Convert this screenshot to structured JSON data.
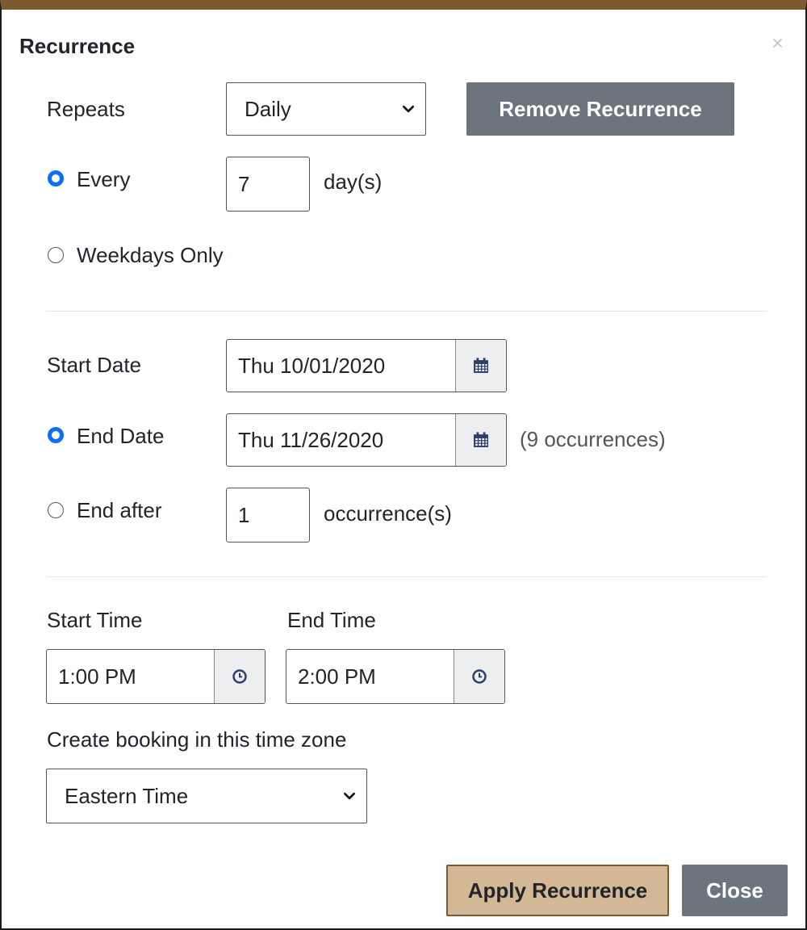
{
  "dialog": {
    "title": "Recurrence",
    "close_glyph": "×"
  },
  "repeats": {
    "label": "Repeats",
    "selected": "Daily",
    "remove_button": "Remove Recurrence"
  },
  "frequency": {
    "every_label": "Every",
    "every_value": "7",
    "every_unit": "day(s)",
    "every_checked": true,
    "weekdays_label": "Weekdays Only",
    "weekdays_checked": false
  },
  "dates": {
    "start_label": "Start Date",
    "start_value": "Thu 10/01/2020",
    "end_label": "End Date",
    "end_value": "Thu 11/26/2020",
    "end_checked": true,
    "occurrences_note": "(9 occurrences)",
    "end_after_label": "End after",
    "end_after_value": "1",
    "end_after_unit": "occurrence(s)",
    "end_after_checked": false
  },
  "times": {
    "start_label": "Start Time",
    "start_value": "1:00 PM",
    "end_label": "End Time",
    "end_value": "2:00 PM"
  },
  "timezone": {
    "label": "Create booking in this time zone",
    "selected": "Eastern Time"
  },
  "footer": {
    "apply_button": "Apply Recurrence",
    "close_button": "Close"
  },
  "colors": {
    "accent_border": "#7a5a2e",
    "apply_bg": "#d4b896",
    "gray_button": "#6c757d",
    "radio_checked": "#0d6efd",
    "addon_icon": "#2c3e6e"
  },
  "icons": {
    "select_arrow": "chevron-down-icon",
    "date_picker": "calendar-icon",
    "time_picker": "clock-icon",
    "close": "close-icon"
  }
}
